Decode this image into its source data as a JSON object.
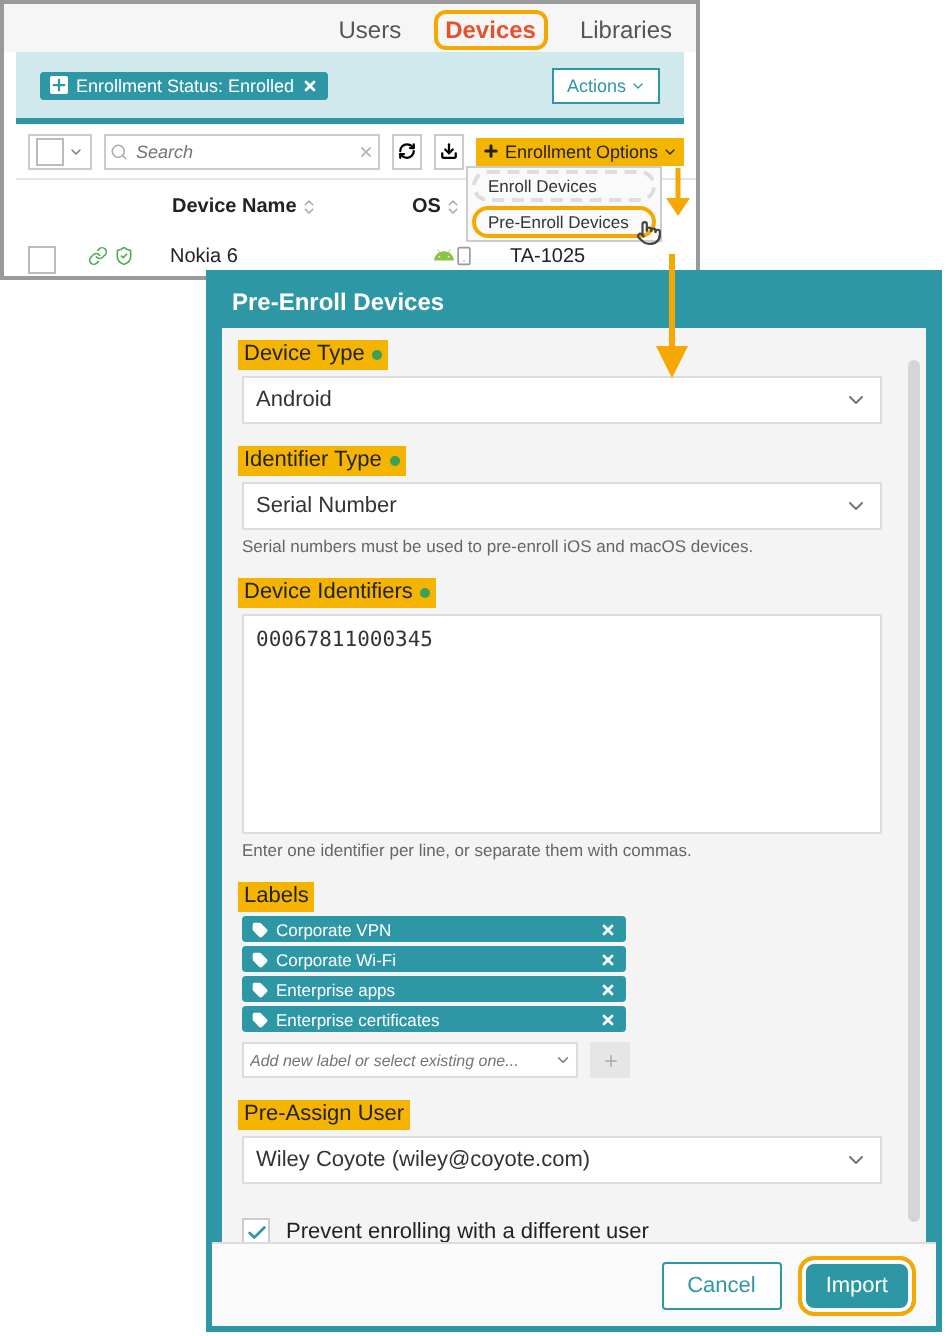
{
  "nav_tabs": [
    {
      "label": "Users",
      "selected": false
    },
    {
      "label": "Devices",
      "selected": true
    },
    {
      "label": "Libraries",
      "selected": false
    }
  ],
  "filter_chip": "Enrollment Status: Enrolled",
  "actions_button": "Actions",
  "search": {
    "placeholder": "Search"
  },
  "enrollment_button": "Enrollment Options",
  "enrollment_menu": [
    {
      "label": "Enroll Devices",
      "selected": false
    },
    {
      "label": "Pre-Enroll Devices",
      "selected": true
    }
  ],
  "table": {
    "columns": [
      "Device Name",
      "OS"
    ],
    "rows": [
      {
        "checked": false,
        "device_name": "Nokia 6",
        "column_4": "TA-1025"
      }
    ]
  },
  "dialog": {
    "title": "Pre-Enroll Devices",
    "fields": [
      {
        "kind": "select",
        "label": "Device Type",
        "required": true,
        "highlighted": true,
        "value": "Android"
      },
      {
        "kind": "select",
        "label": "Identifier Type",
        "required": true,
        "highlighted": true,
        "value": "Serial Number",
        "hint": "Serial numbers must be used to pre-enroll iOS and macOS devices."
      },
      {
        "kind": "textarea",
        "label": "Device Identifiers",
        "required": true,
        "highlighted": true,
        "value": "00067811000345",
        "hint": "Enter one identifier per line, or separate them with commas."
      },
      {
        "kind": "tags",
        "label": "Labels",
        "highlighted": true,
        "tags": [
          "Corporate VPN",
          "Corporate Wi-Fi",
          "Enterprise apps",
          "Enterprise certificates"
        ],
        "placeholder": "Add new label or select existing one..."
      },
      {
        "kind": "select",
        "label": "Pre-Assign User",
        "highlighted": true,
        "value": "Wiley Coyote (wiley@coyote.com)"
      },
      {
        "kind": "checkbox",
        "label": "Prevent enrolling with a different user",
        "checked": true
      }
    ],
    "buttons": [
      {
        "label": "Cancel",
        "primary": false,
        "highlighted": false
      },
      {
        "label": "Import",
        "primary": true,
        "highlighted": true
      }
    ]
  }
}
